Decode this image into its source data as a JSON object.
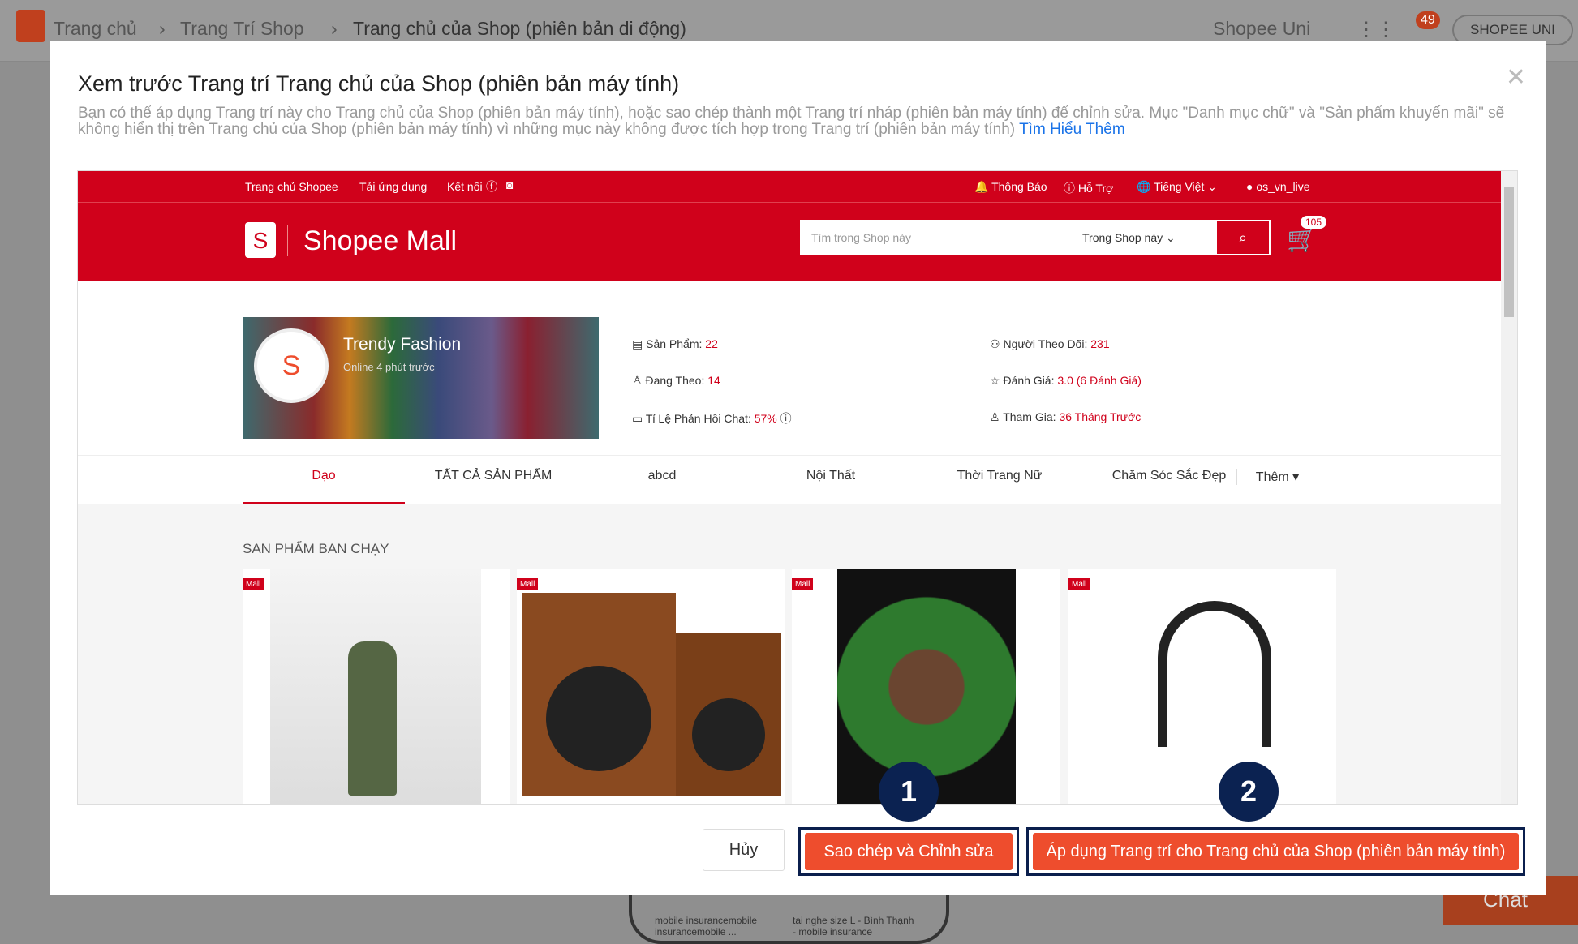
{
  "background": {
    "breadcrumb": [
      "Trang chủ",
      "Trang Trí Shop",
      "Trang chủ của Shop (phiên bản di động)"
    ],
    "shopee_uni": "Shopee Uni",
    "notif_count": "49",
    "account": "SHOPEE UNI",
    "chat": "Chat",
    "items": [
      "mobile insurancemobile insurancemobile ...",
      "tai nghe size L - Bình Thạnh - mobile insurance"
    ]
  },
  "modal": {
    "title": "Xem trước Trang trí Trang chủ của Shop (phiên bản máy tính)",
    "description": "Bạn có thể áp dụng Trang trí này cho Trang chủ của Shop (phiên bản máy tính), hoặc sao chép thành một Trang trí nháp (phiên bản máy tính) để chỉnh sửa. Mục \"Danh mục chữ\" và \"Sản phẩm khuyến mãi\" sẽ không hiển thị trên Trang chủ của Shop (phiên bản máy tính) vì những mục này không được tích hợp trong Trang trí (phiên bản máy tính)",
    "learn_more": "Tìm Hiểu Thêm",
    "cancel": "Hủy",
    "copy_edit": "Sao chép và Chỉnh sửa",
    "apply": "Áp dụng Trang trí cho Trang chủ của Shop (phiên bản máy tính)",
    "markers": [
      "1",
      "2"
    ]
  },
  "preview": {
    "topbar": {
      "left": [
        "Trang chủ Shopee",
        "Tải ứng dụng",
        "Kết nối"
      ],
      "notifications": "Thông Báo",
      "help": "Hỗ Trợ",
      "language": "Tiếng Việt",
      "user": "os_vn_live"
    },
    "logo": "Shopee Mall",
    "search_placeholder": "Tìm trong Shop này",
    "search_scope": "Trong Shop này",
    "cart_count": "105",
    "shop": {
      "name": "Trendy Fashion",
      "status": "Online 4 phút trước"
    },
    "stats": [
      {
        "label": "Sản Phẩm: ",
        "value": "22"
      },
      {
        "label": "Người Theo Dõi: ",
        "value": "231"
      },
      {
        "label": "Đang Theo: ",
        "value": "14"
      },
      {
        "label": "Đánh Giá: ",
        "value": "3.0 (6 Đánh Giá)"
      },
      {
        "label": "Tỉ Lệ Phản Hồi Chat: ",
        "value": "57%"
      },
      {
        "label": "Tham Gia: ",
        "value": "36 Tháng Trước"
      }
    ],
    "tabs": [
      "Dạo",
      "TẤT CẢ SẢN PHẨM",
      "abcd",
      "Nội Thất",
      "Thời Trang Nữ",
      "Chăm Sóc Sắc Đẹp",
      "Thêm"
    ],
    "section_title": "SAN PHẨM BAN CHẠY",
    "badge": "Mall"
  },
  "colors": {
    "shopee_red": "#d0011b",
    "button_orange": "#ee4d2d",
    "marker_navy": "#0b2251"
  }
}
